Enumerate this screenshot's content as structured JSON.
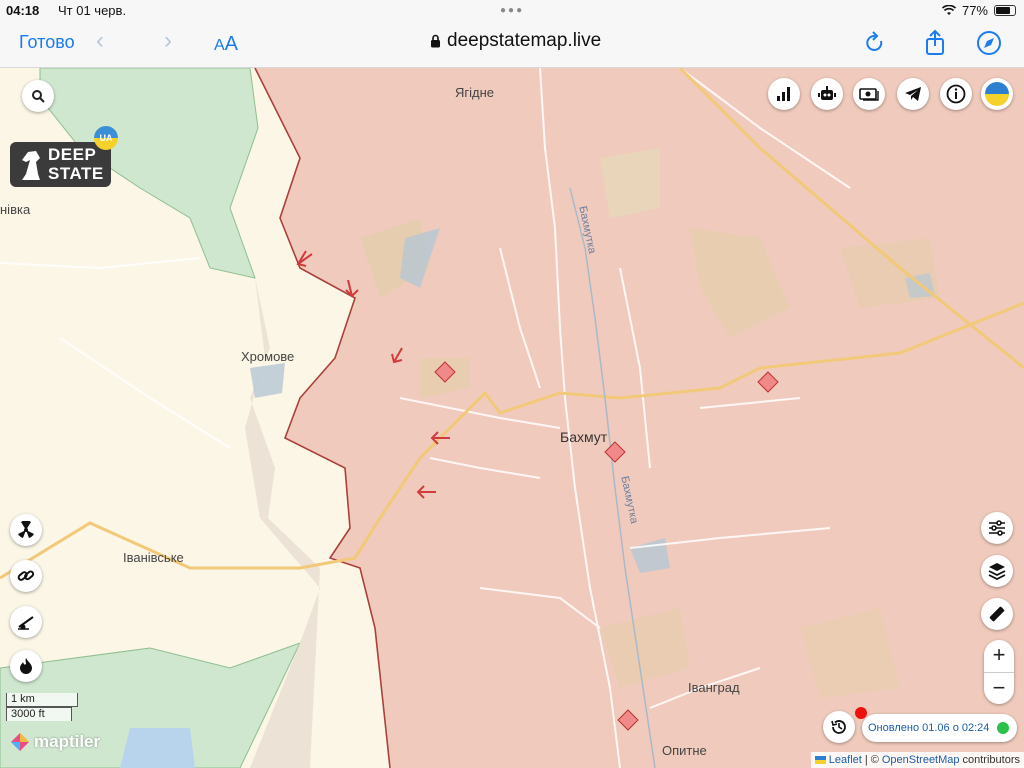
{
  "status_bar": {
    "time": "04:18",
    "date": "Чт 01 черв.",
    "battery": "77%",
    "battery_level": 0.77
  },
  "browser": {
    "done_label": "Готово",
    "text_size_label_small": "A",
    "text_size_label_big": "A",
    "url": "deepstatemap.live"
  },
  "map": {
    "places": {
      "yahidne": "Ягідне",
      "khromove": "Хромове",
      "bakhmut": "Бахмут",
      "ivanivske": "Іванівське",
      "ivanhrad": "Іванград",
      "opytne": "Опитне",
      "edge_label": "нівка",
      "river_north": "Бахмутка",
      "river_south": "Бахмутка"
    },
    "logo": {
      "line1": "DEEP",
      "line2": "STATE"
    },
    "ua_badge": "UA",
    "scale": {
      "metric": "1 km",
      "imperial": "3000 ft"
    },
    "maptiler": "maptiler",
    "updated": "Оновлено 01.06 о 02:24",
    "zoom": {
      "in": "+",
      "out": "−"
    },
    "attribution": {
      "leaflet": "Leaflet",
      "sep": " | © ",
      "osm": "OpenStreetMap",
      "suffix": " contributors"
    }
  },
  "colors": {
    "occupied": "#f0c8b8",
    "contested": "#ece0d8",
    "liberated": "#cfe6cf",
    "frontline": "#a8423a",
    "accent": "#1a7cf0"
  }
}
